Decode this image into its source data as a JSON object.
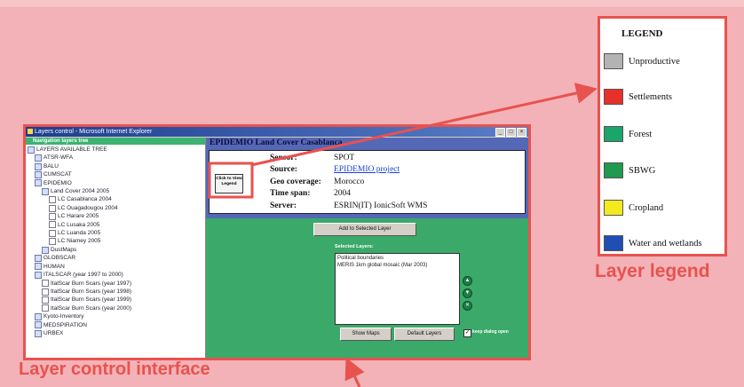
{
  "window": {
    "title": "Layers control - Microsoft Internet Explorer",
    "controls": [
      "_",
      "□",
      "×"
    ]
  },
  "navigation": {
    "header": "Navigation layers tree",
    "tree": [
      {
        "label": "LAYERS AVAILABLE TREE",
        "level": 0,
        "icon": "tree-root-icon"
      },
      {
        "label": "ATSR-WFA",
        "level": 1,
        "icon": "folder-icon"
      },
      {
        "label": "BALU",
        "level": 1,
        "icon": "folder-icon"
      },
      {
        "label": "CUMSCAT",
        "level": 1,
        "icon": "folder-icon"
      },
      {
        "label": "EPIDEMIO",
        "level": 1,
        "icon": "folder-icon"
      },
      {
        "label": "Land Cover 2004 2005",
        "level": 2,
        "icon": "folder-icon"
      },
      {
        "label": "LC Casablanca 2004",
        "level": 3,
        "icon": "document-icon"
      },
      {
        "label": "LC Ouagadougou 2004",
        "level": 3,
        "icon": "document-icon"
      },
      {
        "label": "LC Harare 2005",
        "level": 3,
        "icon": "document-icon"
      },
      {
        "label": "LC Lusaka 2005",
        "level": 3,
        "icon": "document-icon"
      },
      {
        "label": "LC Luanda 2005",
        "level": 3,
        "icon": "document-icon"
      },
      {
        "label": "LC Niamey 2005",
        "level": 3,
        "icon": "document-icon"
      },
      {
        "label": "DustMaps",
        "level": 2,
        "icon": "folder-icon"
      },
      {
        "label": "GLOBSCAR",
        "level": 1,
        "icon": "folder-icon"
      },
      {
        "label": "HUMAN",
        "level": 1,
        "icon": "folder-icon"
      },
      {
        "label": "ITALSCAR (year 1997 to 2000)",
        "level": 1,
        "icon": "folder-icon"
      },
      {
        "label": "ItalScar Burn Scars (year 1997)",
        "level": 2,
        "icon": "document-icon"
      },
      {
        "label": "ItalScar Burn Scars (year 1998)",
        "level": 2,
        "icon": "document-icon"
      },
      {
        "label": "ItalScar Burn Scars (year 1999)",
        "level": 2,
        "icon": "document-icon"
      },
      {
        "label": "ItalScar Burn Scars (year 2000)",
        "level": 2,
        "icon": "document-icon"
      },
      {
        "label": "Kyoto-Inventory",
        "level": 1,
        "icon": "folder-icon"
      },
      {
        "label": "MEDSPIRATION",
        "level": 1,
        "icon": "folder-icon"
      },
      {
        "label": "URBEX",
        "level": 1,
        "icon": "folder-icon"
      }
    ]
  },
  "info": {
    "title": "EPIDEMIO Land Cover Casablanca",
    "legend_button": "Click to View Legend",
    "rows": [
      {
        "key": "Sensor:",
        "value": "SPOT",
        "link": false
      },
      {
        "key": "Source:",
        "value": "EPIDEMIO project",
        "link": true
      },
      {
        "key": "Geo coverage:",
        "value": "Morocco",
        "link": false
      },
      {
        "key": "Time span:",
        "value": "2004",
        "link": false
      },
      {
        "key": "Server:",
        "value": "ESRIN(IT) IonicSoft WMS",
        "link": false
      }
    ]
  },
  "actions": {
    "add_layer": "Add to Selected Layer",
    "selected_label": "Selected Layers:",
    "selected_layers": [
      "Political boundaries",
      "MERIS 1km global mosaic (Mar 2003)"
    ],
    "show_maps": "Show Maps",
    "default_layers": "Default Layers",
    "keep_dialog": "keep dialog open",
    "keep_checked": true
  },
  "legend": {
    "title": "LEGEND",
    "items": [
      {
        "label": "Unproductive",
        "color": "#b3b3b3"
      },
      {
        "label": "Settlements",
        "color": "#e8302a"
      },
      {
        "label": "Forest",
        "color": "#1aa56a"
      },
      {
        "label": "SBWG",
        "color": "#1f9a4e"
      },
      {
        "label": "Cropland",
        "color": "#f2ea1c"
      },
      {
        "label": "Water and wetlands",
        "color": "#1f4fb3"
      }
    ]
  },
  "captions": {
    "layer_control": "Layer control interface",
    "layer_legend": "Layer legend"
  },
  "colors": {
    "background": "#f3b2b7",
    "annotation": "#e8524f",
    "panel_green": "#3aa969",
    "header_blue": "#5568b5"
  }
}
